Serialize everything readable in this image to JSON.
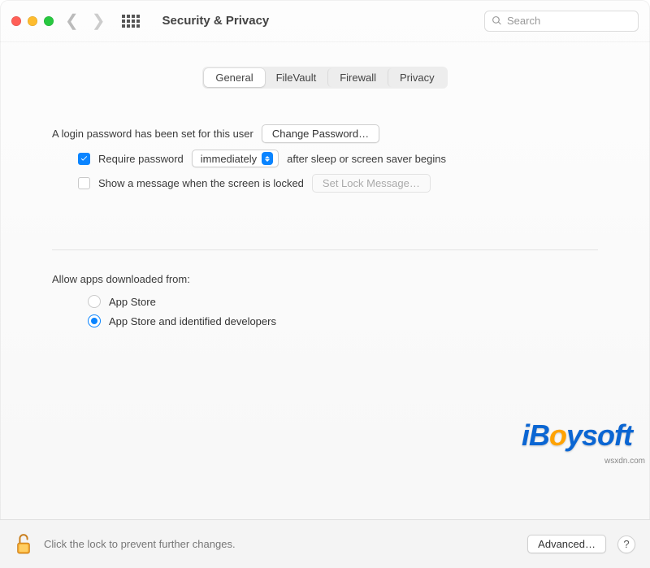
{
  "toolbar": {
    "title": "Security & Privacy",
    "search_placeholder": "Search"
  },
  "tabs": {
    "items": [
      "General",
      "FileVault",
      "Firewall",
      "Privacy"
    ],
    "active_index": 0
  },
  "general": {
    "login_password_text": "A login password has been set for this user",
    "change_password_btn": "Change Password…",
    "require_password_checked": true,
    "require_password_label_pre": "Require password",
    "require_password_delay": "immediately",
    "require_password_label_post": "after sleep or screen saver begins",
    "show_message_checked": false,
    "show_message_label": "Show a message when the screen is locked",
    "set_lock_message_btn": "Set Lock Message…",
    "set_lock_message_enabled": false,
    "allow_apps_label": "Allow apps downloaded from:",
    "allow_apps_options": [
      {
        "label": "App Store",
        "selected": false
      },
      {
        "label": "App Store and identified developers",
        "selected": true
      }
    ]
  },
  "footer": {
    "lock_text": "Click the lock to prevent further changes.",
    "advanced_btn": "Advanced…",
    "help": "?"
  },
  "watermark": {
    "brand_pre": "iB",
    "brand_o": "o",
    "brand_post": "ysoft",
    "url": "wsxdn.com"
  }
}
